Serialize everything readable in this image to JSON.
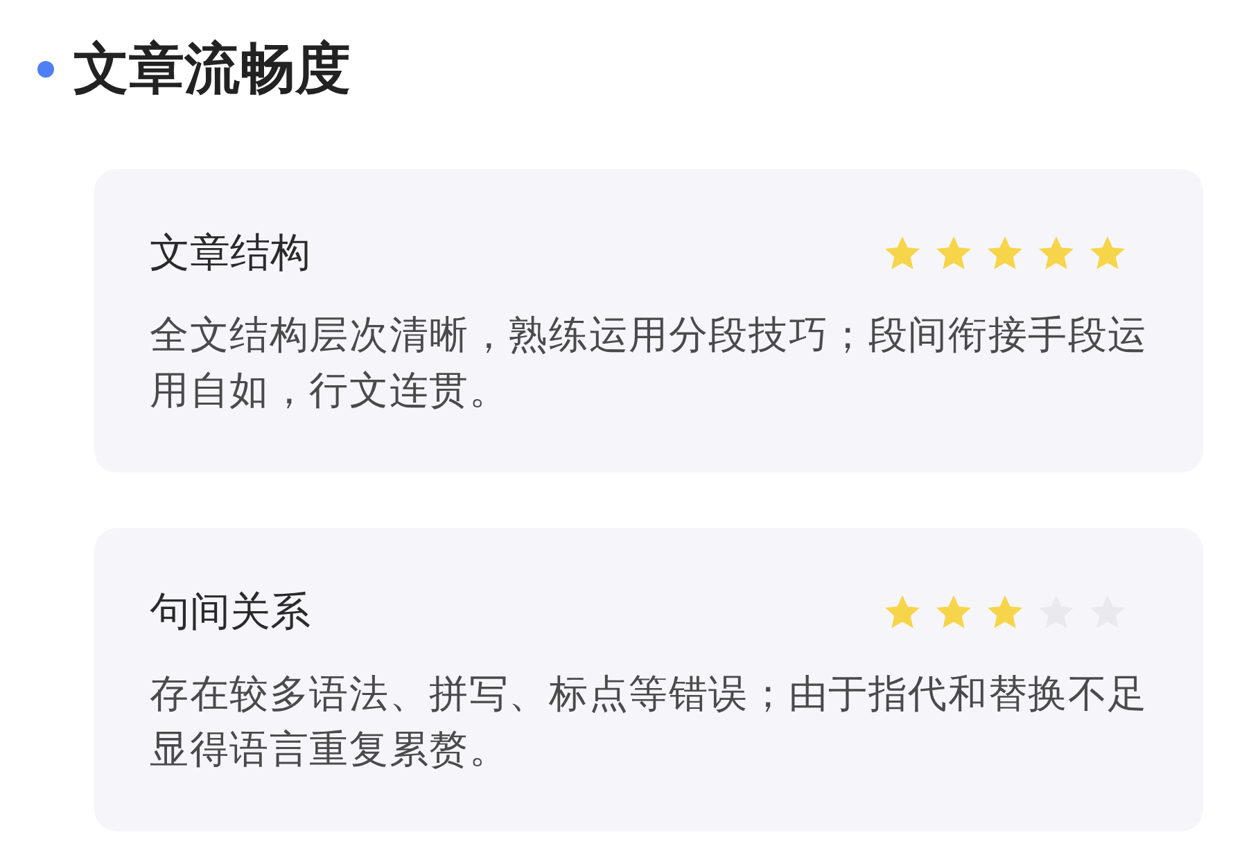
{
  "section": {
    "title": "文章流畅度"
  },
  "cards": [
    {
      "title": "文章结构",
      "stars": 5,
      "description": "全文结构层次清晰，熟练运用分段技巧；段间衔接手段运用自如，行文连贯。"
    },
    {
      "title": "句间关系",
      "stars": 3,
      "description": "存在较多语法、拼写、标点等错误；由于指代和替换不足显得语言重复累赘。"
    }
  ]
}
